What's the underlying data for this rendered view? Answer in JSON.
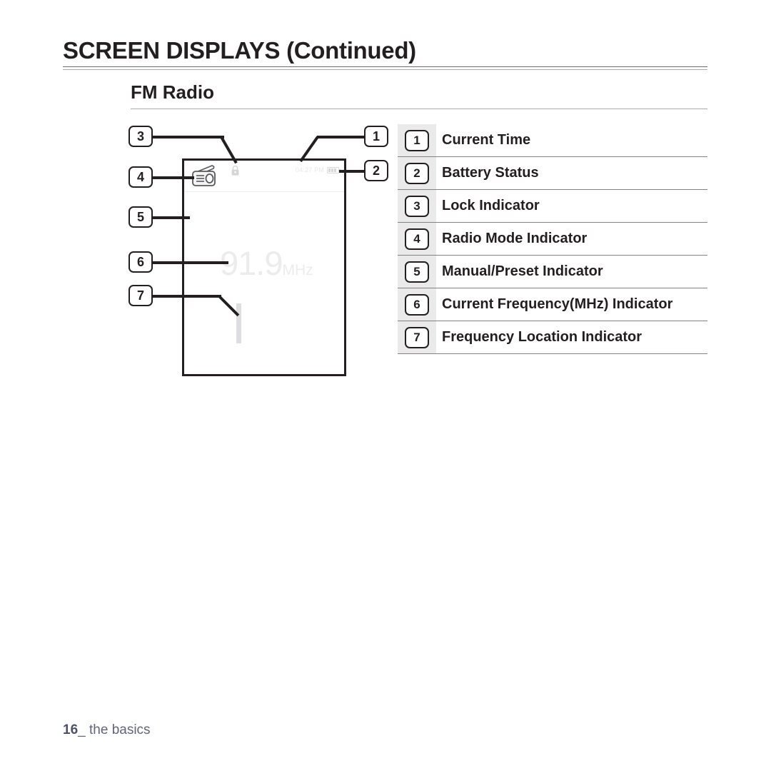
{
  "header": {
    "title": "SCREEN DISPLAYS (Continued)",
    "section_title": "FM Radio"
  },
  "device": {
    "status_time": "04:27 PM",
    "frequency_value": "91.9",
    "frequency_unit": "MHz",
    "icons": {
      "lock": "lock-icon",
      "radio_mode": "radio-mode-icon",
      "battery": "battery-icon"
    }
  },
  "callouts": [
    {
      "number": "1"
    },
    {
      "number": "2"
    },
    {
      "number": "3"
    },
    {
      "number": "4"
    },
    {
      "number": "5"
    },
    {
      "number": "6"
    },
    {
      "number": "7"
    }
  ],
  "legend": [
    {
      "number": "1",
      "label": "Current Time"
    },
    {
      "number": "2",
      "label": "Battery Status"
    },
    {
      "number": "3",
      "label": "Lock Indicator"
    },
    {
      "number": "4",
      "label": "Radio Mode Indicator"
    },
    {
      "number": "5",
      "label": "Manual/Preset Indicator"
    },
    {
      "number": "6",
      "label": "Current Frequency(MHz) Indicator"
    },
    {
      "number": "7",
      "label": "Frequency Location Indicator"
    }
  ],
  "footer": {
    "page_number": "16",
    "separator": "_",
    "section": "the basics"
  },
  "colors": {
    "ink": "#231f20",
    "rule": "#808285",
    "band": "#eaeaeb",
    "screen_text": "#ececec",
    "footer_text": "#61657a"
  }
}
